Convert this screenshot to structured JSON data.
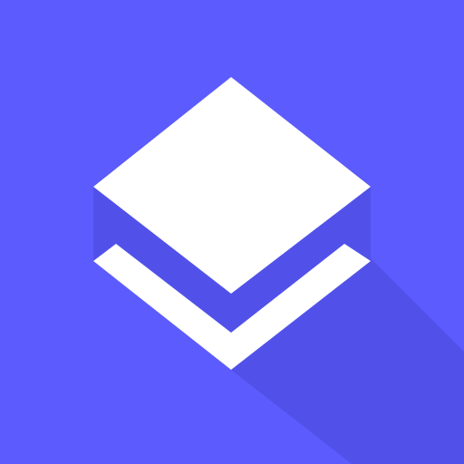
{
  "icon": {
    "name": "layers-icon",
    "background_color": "#5c5cfe",
    "long_shadow_color": "#4f4fe6",
    "glyph_color": "#ffffff"
  }
}
